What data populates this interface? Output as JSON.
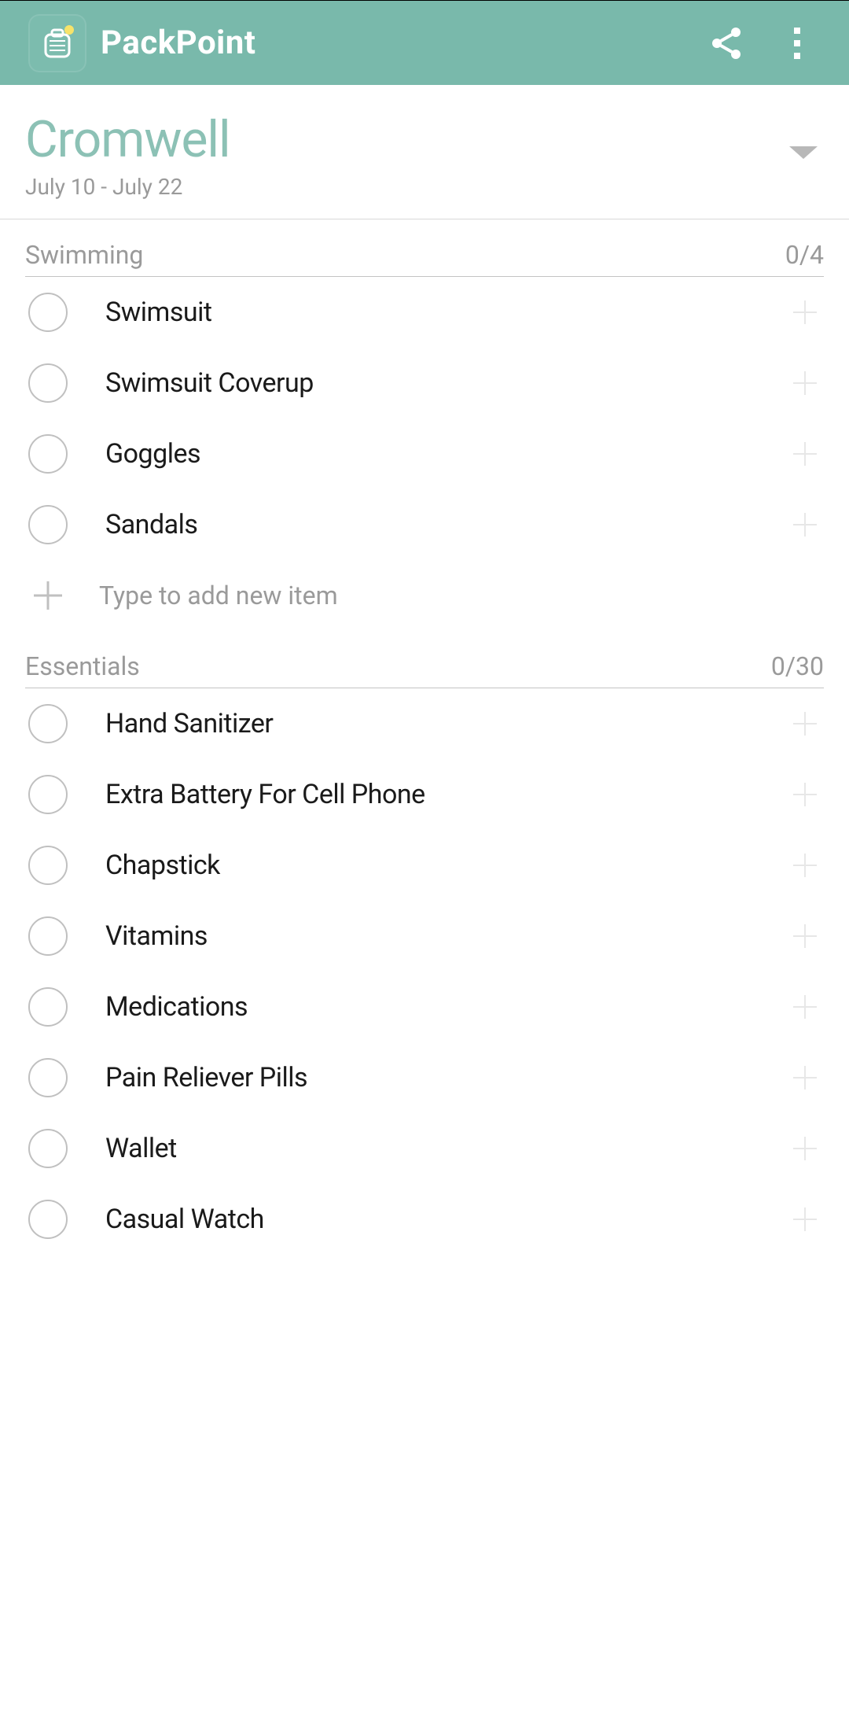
{
  "app": {
    "title": "PackPoint"
  },
  "trip": {
    "name": "Cromwell",
    "dates": "July 10 - July 22"
  },
  "addItemPlaceholder": "Type to add new item",
  "sections": [
    {
      "title": "Swimming",
      "count": "0/4",
      "items": [
        {
          "label": "Swimsuit"
        },
        {
          "label": "Swimsuit Coverup"
        },
        {
          "label": "Goggles"
        },
        {
          "label": "Sandals"
        }
      ],
      "showAddRow": true
    },
    {
      "title": "Essentials",
      "count": "0/30",
      "items": [
        {
          "label": "Hand Sanitizer"
        },
        {
          "label": "Extra Battery For Cell Phone"
        },
        {
          "label": "Chapstick"
        },
        {
          "label": "Vitamins"
        },
        {
          "label": "Medications"
        },
        {
          "label": "Pain Reliever Pills"
        },
        {
          "label": "Wallet"
        },
        {
          "label": "Casual Watch"
        }
      ],
      "showAddRow": false
    }
  ]
}
